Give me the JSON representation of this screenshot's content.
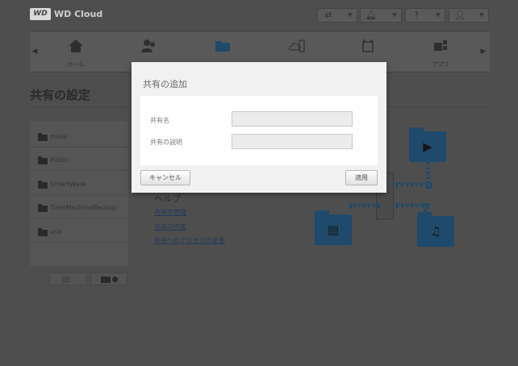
{
  "header": {
    "logo_mark": "WD",
    "logo_text": "WD Cloud",
    "buttons": [
      "usb-icon",
      "bell-icon",
      "help-icon",
      "user-icon"
    ]
  },
  "nav": {
    "items": [
      {
        "label": "ホーム",
        "icon": "home-icon"
      },
      {
        "label": "",
        "icon": "users-icon"
      },
      {
        "label": "",
        "icon": "folder-icon"
      },
      {
        "label": "",
        "icon": "cloud-device-icon"
      },
      {
        "label": "",
        "icon": "backup-icon"
      },
      {
        "label": "アプリ",
        "icon": "apps-icon"
      }
    ]
  },
  "page": {
    "title": "共有の設定"
  },
  "shares": [
    {
      "name": "mikai"
    },
    {
      "name": "Public"
    },
    {
      "name": "SmartWare"
    },
    {
      "name": "TimeMachineBackup"
    },
    {
      "name": "usb"
    }
  ],
  "help": {
    "heading": "ヘルプ",
    "links": [
      "共有の管理",
      "共有の作成",
      "共有へのアクセスの変更"
    ]
  },
  "modal": {
    "title": "共有の追加",
    "share_name_label": "共有名",
    "share_name_value": "",
    "share_desc_label": "共有の説明",
    "share_desc_value": "",
    "cancel_label": "キャンセル",
    "apply_label": "適用"
  },
  "colors": {
    "background": "#4e4e4e",
    "modal_bg": "#f1f1f1",
    "illustration_blue": "#1f4a6b",
    "link": "#213a5a"
  }
}
